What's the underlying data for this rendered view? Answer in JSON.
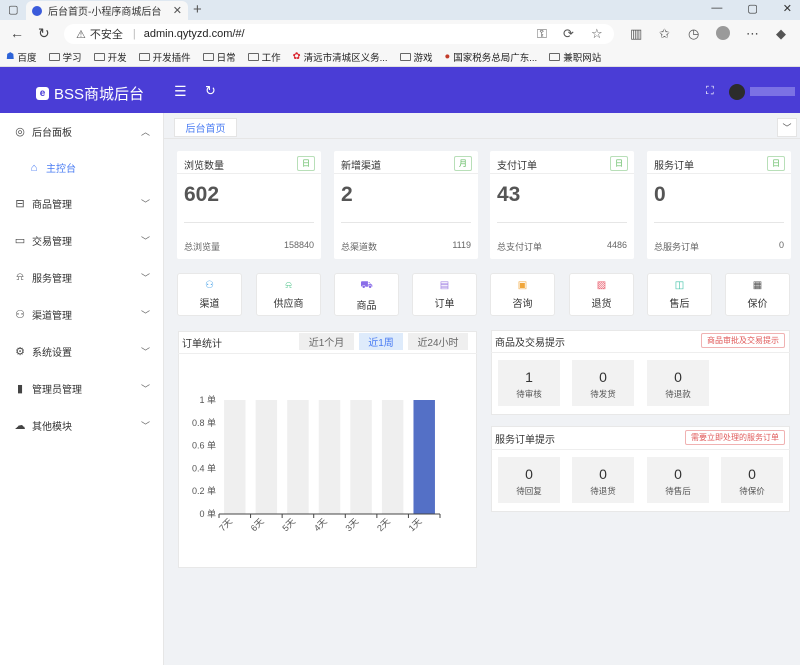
{
  "browser": {
    "tab_title": "后台首页-小程序商城后台",
    "security_text": "不安全",
    "url": "admin.qytyzd.com/#/",
    "bookmarks": [
      "百度",
      "学习",
      "开发",
      "开发插件",
      "日常",
      "工作",
      "清远市清城区义务...",
      "游戏",
      "国家税务总局广东...",
      "兼职网站"
    ]
  },
  "header": {
    "brand": "BSS商城后台"
  },
  "sidebar": {
    "items": [
      {
        "label": "后台面板",
        "icon": "dashboard-icon",
        "expanded": true
      },
      {
        "label": "主控台",
        "icon": "home-icon",
        "active": true
      },
      {
        "label": "商品管理",
        "icon": "bag-icon"
      },
      {
        "label": "交易管理",
        "icon": "card-icon"
      },
      {
        "label": "服务管理",
        "icon": "bell-icon"
      },
      {
        "label": "渠道管理",
        "icon": "user-icon"
      },
      {
        "label": "系统设置",
        "icon": "gear-icon"
      },
      {
        "label": "管理员管理",
        "icon": "admin-icon"
      },
      {
        "label": "其他模块",
        "icon": "cloud-icon"
      }
    ]
  },
  "breadcrumb_tab": "后台首页",
  "stats": [
    {
      "title": "浏览数量",
      "badge": "日",
      "value": "602",
      "foot_label": "总浏览量",
      "total": "158840"
    },
    {
      "title": "新增渠道",
      "badge": "月",
      "value": "2",
      "foot_label": "总渠道数",
      "total": "1119"
    },
    {
      "title": "支付订单",
      "badge": "日",
      "value": "43",
      "foot_label": "总支付订单",
      "total": "4486"
    },
    {
      "title": "服务订单",
      "badge": "日",
      "value": "0",
      "foot_label": "总服务订单",
      "total": "0"
    }
  ],
  "quick_links": [
    {
      "label": "渠道",
      "icon": "user-icon",
      "color": "#4aa3e8"
    },
    {
      "label": "供应商",
      "icon": "bell-icon",
      "color": "#4cc389"
    },
    {
      "label": "商品",
      "icon": "cart-icon",
      "color": "#8a6ee8"
    },
    {
      "label": "订单",
      "icon": "document-icon",
      "color": "#9b7be0"
    },
    {
      "label": "咨询",
      "icon": "briefcase-icon",
      "color": "#f0a63a"
    },
    {
      "label": "退货",
      "icon": "image-icon",
      "color": "#e85a6a"
    },
    {
      "label": "售后",
      "icon": "chat-icon",
      "color": "#3cc0a6"
    },
    {
      "label": "保价",
      "icon": "receipt-icon",
      "color": "#555555"
    }
  ],
  "order_chart": {
    "title": "订单统计",
    "ranges": [
      "近1个月",
      "近1周",
      "近24小时"
    ],
    "active_range": "近1周"
  },
  "chart_data": {
    "type": "bar",
    "title": "",
    "categories": [
      "7天",
      "6天",
      "5天",
      "4天",
      "3天",
      "2天",
      "1天"
    ],
    "values": [
      0,
      0,
      0,
      0,
      0,
      0,
      1
    ],
    "ylim": [
      0,
      1
    ],
    "yticks": [
      "0 单",
      "0.2 单",
      "0.4 单",
      "0.6 单",
      "0.8 单",
      "1 单"
    ],
    "bar_color": "#5470c6",
    "background_bar_color": "#efefef",
    "grid": false
  },
  "goods_tips": {
    "title": "商品及交易提示",
    "tag": "商品审批及交易提示",
    "items": [
      {
        "value": "1",
        "label": "待审核"
      },
      {
        "value": "0",
        "label": "待发货"
      },
      {
        "value": "0",
        "label": "待退款"
      }
    ]
  },
  "service_tips": {
    "title": "服务订单提示",
    "tag": "需要立即处理的服务订单",
    "items": [
      {
        "value": "0",
        "label": "待回复"
      },
      {
        "value": "0",
        "label": "待退货"
      },
      {
        "value": "0",
        "label": "待售后"
      },
      {
        "value": "0",
        "label": "待保价"
      }
    ]
  }
}
